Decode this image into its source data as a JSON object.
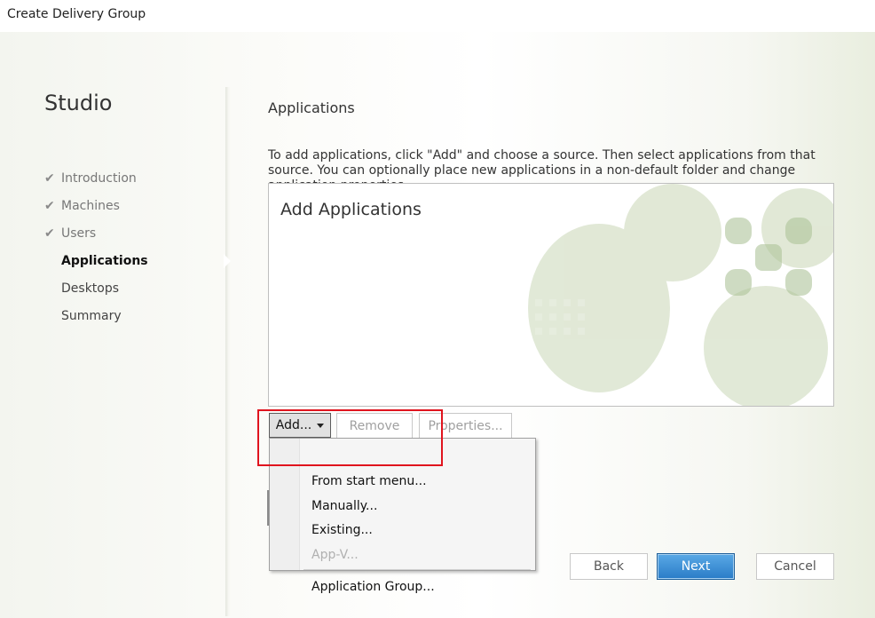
{
  "window": {
    "title": "Create Delivery Group"
  },
  "sidebar": {
    "title": "Studio",
    "items": [
      {
        "label": "Introduction",
        "state": "done"
      },
      {
        "label": "Machines",
        "state": "done"
      },
      {
        "label": "Users",
        "state": "done"
      },
      {
        "label": "Applications",
        "state": "current"
      },
      {
        "label": "Desktops",
        "state": "pending"
      },
      {
        "label": "Summary",
        "state": "pending"
      }
    ]
  },
  "main": {
    "title": "Applications",
    "description": "To add applications, click \"Add\" and choose a source. Then select applications from that source. You can optionally place new applications in a non-default folder and change application properties.",
    "box_title": "Add Applications"
  },
  "toolbar": {
    "add_label": "Add...",
    "remove_label": "Remove",
    "properties_label": "Properties..."
  },
  "add_menu": {
    "items": [
      {
        "label": "From start menu...",
        "enabled": true
      },
      {
        "label": "Manually...",
        "enabled": true
      },
      {
        "label": "Existing...",
        "enabled": true
      },
      {
        "label": "App-V...",
        "enabled": false
      },
      {
        "label": "Application Group...",
        "enabled": true
      }
    ]
  },
  "footer": {
    "back_label": "Back",
    "next_label": "Next",
    "cancel_label": "Cancel"
  },
  "colors": {
    "highlight_border": "#e0141e",
    "next_button": "#2a7cc7",
    "logo_green": "#c9d7b6"
  }
}
